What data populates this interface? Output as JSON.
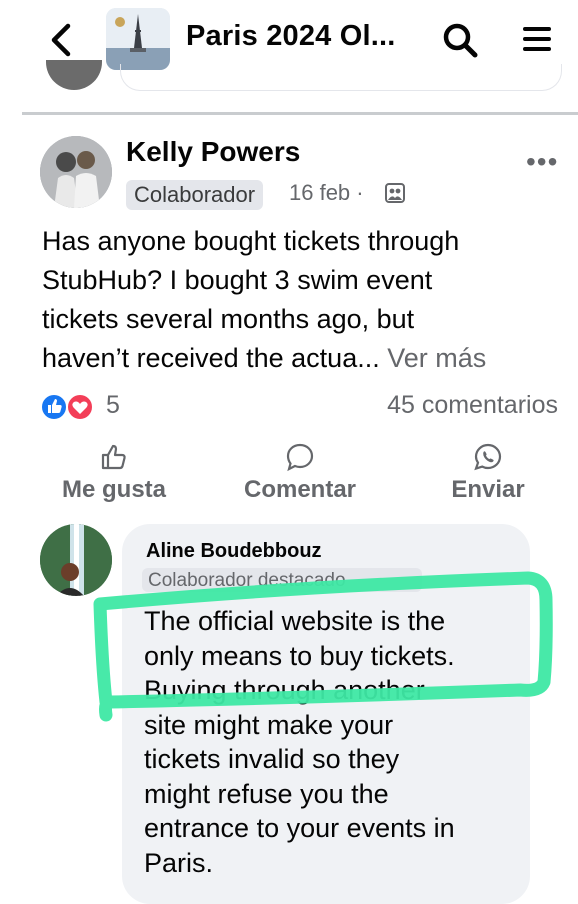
{
  "header": {
    "title": "Paris 2024 Ol...",
    "back_icon": "chevron-left-icon",
    "search_icon": "search-icon",
    "menu_icon": "hamburger-menu-icon"
  },
  "post": {
    "author": "Kelly Powers",
    "badge": "Colaborador",
    "date": "16 feb ·",
    "audience_icon": "group-audience-icon",
    "text_lines": [
      "Has anyone bought tickets through",
      "StubHub? I bought 3 swim event",
      "tickets several months ago, but",
      "haven’t received the actua..."
    ],
    "see_more": "Ver más",
    "reaction_count": "5",
    "comment_count": "45 comentarios",
    "reaction_icons": [
      "like-reaction-icon",
      "love-reaction-icon"
    ],
    "actions": {
      "like": "Me gusta",
      "comment": "Comentar",
      "send": "Enviar"
    }
  },
  "comment": {
    "author": "Aline Boudebbouz",
    "badge": "Colaborador destacado",
    "text_lines": [
      "The official website is the",
      "only means to buy tickets.",
      "Buying through another",
      "site might make your",
      "tickets invalid so they",
      "might refuse you the",
      "entrance to your events in",
      "Paris."
    ]
  },
  "colors": {
    "facebook_blue": "#1877f2",
    "love_red": "#f33e58",
    "highlight_green": "#3ee8a4",
    "muted_text": "#65676b",
    "bubble_bg": "#f0f2f5"
  }
}
